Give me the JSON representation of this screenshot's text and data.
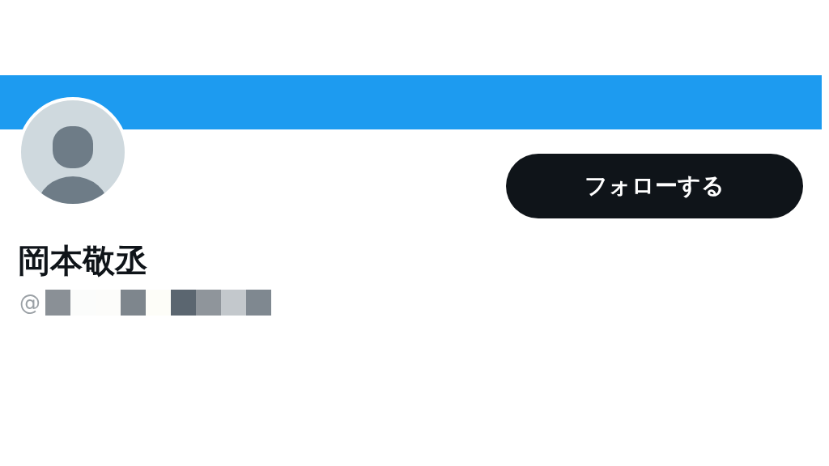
{
  "profile": {
    "name": "岡本敬丞",
    "handle_prefix": "@",
    "follow_button": "フォローする"
  }
}
